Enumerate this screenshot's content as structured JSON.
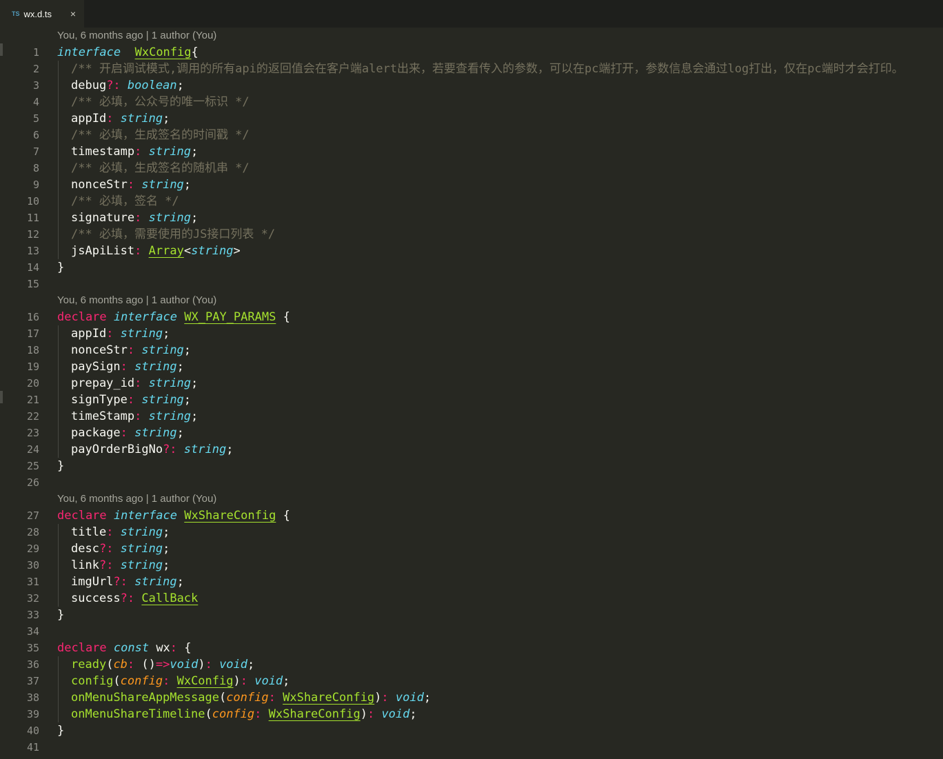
{
  "tab": {
    "icon": "TS",
    "name": "wx.d.ts",
    "close": "×"
  },
  "lens": {
    "a": "You, 6 months ago | 1 author (You)",
    "b": "You, 6 months ago | 1 author (You)",
    "c": "You, 6 months ago | 1 author (You)"
  },
  "lines": [
    {
      "n": "1",
      "t": [
        [
          "kw-i",
          "interface"
        ],
        [
          "",
          "  "
        ],
        [
          "type",
          "WxConfig"
        ],
        [
          "",
          "{"
        ]
      ]
    },
    {
      "n": "2",
      "i": 1,
      "t": [
        [
          "cmt",
          "/** 开启调试模式,调用的所有api的返回值会在客户端alert出来，若要查看传入的参数，可以在pc端打开，参数信息会通过log打出，仅在pc端时才会打印。"
        ]
      ]
    },
    {
      "n": "3",
      "i": 1,
      "t": [
        [
          "",
          "debug"
        ],
        [
          "op",
          "?:"
        ],
        [
          "",
          ""
        ],
        [
          "kw-i",
          " boolean"
        ],
        [
          "",
          ";"
        ]
      ]
    },
    {
      "n": "4",
      "i": 1,
      "t": [
        [
          "cmt",
          "/** 必填，公众号的唯一标识 */"
        ]
      ]
    },
    {
      "n": "5",
      "i": 1,
      "t": [
        [
          "",
          "appId"
        ],
        [
          "op",
          ":"
        ],
        [
          "kw-i",
          " string"
        ],
        [
          "",
          ";"
        ]
      ]
    },
    {
      "n": "6",
      "i": 1,
      "t": [
        [
          "cmt",
          "/** 必填，生成签名的时间戳 */"
        ]
      ]
    },
    {
      "n": "7",
      "i": 1,
      "t": [
        [
          "",
          "timestamp"
        ],
        [
          "op",
          ":"
        ],
        [
          "kw-i",
          " string"
        ],
        [
          "",
          ";"
        ]
      ]
    },
    {
      "n": "8",
      "i": 1,
      "t": [
        [
          "cmt",
          "/** 必填，生成签名的随机串 */"
        ]
      ]
    },
    {
      "n": "9",
      "i": 1,
      "t": [
        [
          "",
          "nonceStr"
        ],
        [
          "op",
          ":"
        ],
        [
          "kw-i",
          " string"
        ],
        [
          "",
          ";"
        ]
      ]
    },
    {
      "n": "10",
      "i": 1,
      "t": [
        [
          "cmt",
          "/** 必填，签名 */"
        ]
      ]
    },
    {
      "n": "11",
      "i": 1,
      "t": [
        [
          "",
          "signature"
        ],
        [
          "op",
          ":"
        ],
        [
          "kw-i",
          " string"
        ],
        [
          "",
          ";"
        ]
      ]
    },
    {
      "n": "12",
      "i": 1,
      "t": [
        [
          "cmt",
          "/** 必填，需要使用的JS接口列表 */"
        ]
      ]
    },
    {
      "n": "13",
      "i": 1,
      "t": [
        [
          "",
          "jsApiList"
        ],
        [
          "op",
          ":"
        ],
        [
          "",
          " "
        ],
        [
          "type",
          "Array"
        ],
        [
          "",
          "<"
        ],
        [
          "kw-i",
          "string"
        ],
        [
          "",
          ">"
        ]
      ]
    },
    {
      "n": "14",
      "t": [
        [
          "",
          "}"
        ]
      ]
    },
    {
      "n": "15",
      "t": []
    },
    {
      "lens": "a"
    },
    {
      "n": "16",
      "t": [
        [
          "kw-r",
          "declare"
        ],
        [
          "kw-i",
          " interface"
        ],
        [
          "",
          " "
        ],
        [
          "type",
          "WX_PAY_PARAMS"
        ],
        [
          "",
          " {"
        ]
      ]
    },
    {
      "n": "17",
      "i": 1,
      "t": [
        [
          "",
          "appId"
        ],
        [
          "op",
          ":"
        ],
        [
          "kw-i",
          " string"
        ],
        [
          "",
          ";"
        ]
      ]
    },
    {
      "n": "18",
      "i": 1,
      "t": [
        [
          "",
          "nonceStr"
        ],
        [
          "op",
          ":"
        ],
        [
          "kw-i",
          " string"
        ],
        [
          "",
          ";"
        ]
      ]
    },
    {
      "n": "19",
      "i": 1,
      "t": [
        [
          "",
          "paySign"
        ],
        [
          "op",
          ":"
        ],
        [
          "kw-i",
          " string"
        ],
        [
          "",
          ";"
        ]
      ]
    },
    {
      "n": "20",
      "i": 1,
      "t": [
        [
          "",
          "prepay_id"
        ],
        [
          "op",
          ":"
        ],
        [
          "kw-i",
          " string"
        ],
        [
          "",
          ";"
        ]
      ]
    },
    {
      "n": "21",
      "i": 1,
      "t": [
        [
          "",
          "signType"
        ],
        [
          "op",
          ":"
        ],
        [
          "kw-i",
          " string"
        ],
        [
          "",
          ";"
        ]
      ]
    },
    {
      "n": "22",
      "i": 1,
      "t": [
        [
          "",
          "timeStamp"
        ],
        [
          "op",
          ":"
        ],
        [
          "kw-i",
          " string"
        ],
        [
          "",
          ";"
        ]
      ]
    },
    {
      "n": "23",
      "i": 1,
      "t": [
        [
          "",
          "package"
        ],
        [
          "op",
          ":"
        ],
        [
          "kw-i",
          " string"
        ],
        [
          "",
          ";"
        ]
      ]
    },
    {
      "n": "24",
      "i": 1,
      "t": [
        [
          "",
          "payOrderBigNo"
        ],
        [
          "op",
          "?:"
        ],
        [
          "kw-i",
          " string"
        ],
        [
          "",
          ";"
        ]
      ]
    },
    {
      "n": "25",
      "t": [
        [
          "",
          "}"
        ]
      ]
    },
    {
      "n": "26",
      "t": []
    },
    {
      "lens": "b"
    },
    {
      "n": "27",
      "t": [
        [
          "kw-r",
          "declare"
        ],
        [
          "kw-i",
          " interface"
        ],
        [
          "",
          " "
        ],
        [
          "type",
          "WxShareConfig"
        ],
        [
          "",
          " {"
        ]
      ]
    },
    {
      "n": "28",
      "i": 1,
      "t": [
        [
          "",
          "title"
        ],
        [
          "op",
          ":"
        ],
        [
          "kw-i",
          " string"
        ],
        [
          "",
          ";"
        ]
      ]
    },
    {
      "n": "29",
      "i": 1,
      "t": [
        [
          "",
          "desc"
        ],
        [
          "op",
          "?:"
        ],
        [
          "kw-i",
          " string"
        ],
        [
          "",
          ";"
        ]
      ]
    },
    {
      "n": "30",
      "i": 1,
      "t": [
        [
          "",
          "link"
        ],
        [
          "op",
          "?:"
        ],
        [
          "kw-i",
          " string"
        ],
        [
          "",
          ";"
        ]
      ]
    },
    {
      "n": "31",
      "i": 1,
      "t": [
        [
          "",
          "imgUrl"
        ],
        [
          "op",
          "?:"
        ],
        [
          "kw-i",
          " string"
        ],
        [
          "",
          ";"
        ]
      ]
    },
    {
      "n": "32",
      "i": 1,
      "t": [
        [
          "",
          "success"
        ],
        [
          "op",
          "?:"
        ],
        [
          "",
          " "
        ],
        [
          "type",
          "CallBack"
        ]
      ]
    },
    {
      "n": "33",
      "t": [
        [
          "",
          "}"
        ]
      ]
    },
    {
      "n": "34",
      "t": []
    },
    {
      "n": "35",
      "t": [
        [
          "kw-r",
          "declare"
        ],
        [
          "kw-i",
          " const"
        ],
        [
          "",
          " wx"
        ],
        [
          "op",
          ":"
        ],
        [
          "",
          " {"
        ]
      ]
    },
    {
      "n": "36",
      "i": 1,
      "t": [
        [
          "fn",
          "ready"
        ],
        [
          "",
          "("
        ],
        [
          "param",
          "cb"
        ],
        [
          "op",
          ":"
        ],
        [
          "",
          " ()"
        ],
        [
          "op",
          "=>"
        ],
        [
          "kw-i",
          "void"
        ],
        [
          "",
          ")"
        ],
        [
          "op",
          ":"
        ],
        [
          "kw-i",
          " void"
        ],
        [
          "",
          ";"
        ]
      ]
    },
    {
      "n": "37",
      "i": 1,
      "t": [
        [
          "fn",
          "config"
        ],
        [
          "",
          "("
        ],
        [
          "param",
          "config"
        ],
        [
          "op",
          ":"
        ],
        [
          "",
          " "
        ],
        [
          "type",
          "WxConfig"
        ],
        [
          "",
          ")"
        ],
        [
          "op",
          ":"
        ],
        [
          "kw-i",
          " void"
        ],
        [
          "",
          ";"
        ]
      ]
    },
    {
      "n": "38",
      "i": 1,
      "t": [
        [
          "fn",
          "onMenuShareAppMessage"
        ],
        [
          "",
          "("
        ],
        [
          "param",
          "config"
        ],
        [
          "op",
          ":"
        ],
        [
          "",
          " "
        ],
        [
          "type",
          "WxShareConfig"
        ],
        [
          "",
          ")"
        ],
        [
          "op",
          ":"
        ],
        [
          "kw-i",
          " void"
        ],
        [
          "",
          ";"
        ]
      ]
    },
    {
      "n": "39",
      "i": 1,
      "t": [
        [
          "fn",
          "onMenuShareTimeline"
        ],
        [
          "",
          "("
        ],
        [
          "param",
          "config"
        ],
        [
          "op",
          ":"
        ],
        [
          "",
          " "
        ],
        [
          "type",
          "WxShareConfig"
        ],
        [
          "",
          ")"
        ],
        [
          "op",
          ":"
        ],
        [
          "kw-i",
          " void"
        ],
        [
          "",
          ";"
        ]
      ]
    },
    {
      "n": "40",
      "t": [
        [
          "",
          "}"
        ]
      ]
    },
    {
      "n": "41",
      "t": []
    }
  ]
}
